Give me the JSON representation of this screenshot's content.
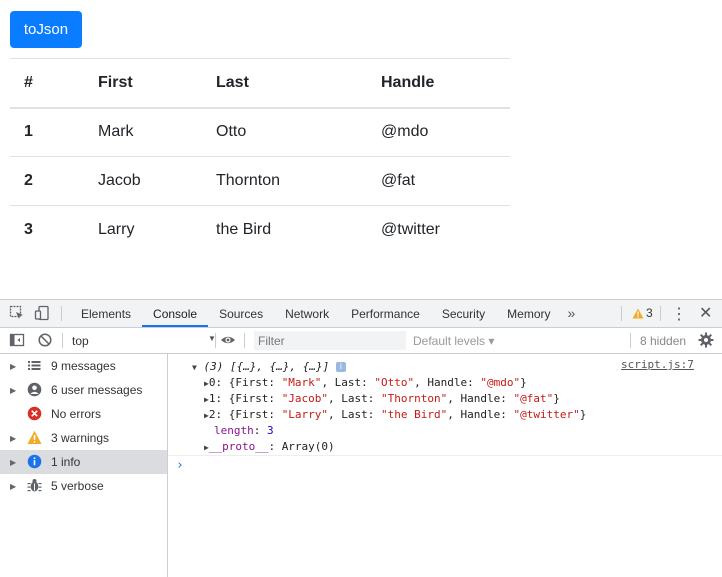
{
  "page": {
    "button_label": "toJson",
    "table": {
      "headers": [
        "#",
        "First",
        "Last",
        "Handle"
      ],
      "rows": [
        [
          "1",
          "Mark",
          "Otto",
          "@mdo"
        ],
        [
          "2",
          "Jacob",
          "Thornton",
          "@fat"
        ],
        [
          "3",
          "Larry",
          "the Bird",
          "@twitter"
        ]
      ]
    }
  },
  "devtools": {
    "tabs": [
      "Elements",
      "Console",
      "Sources",
      "Network",
      "Performance",
      "Security",
      "Memory"
    ],
    "active_tab": "Console",
    "more_tabs": "»",
    "warning_count": "3",
    "context": "top",
    "filter_placeholder": "Filter",
    "levels_label": "Default levels ▾",
    "hidden_count": "8 hidden",
    "sidebar": [
      {
        "label": "9 messages",
        "icon": "list-icon"
      },
      {
        "label": "6 user messages",
        "icon": "user-icon"
      },
      {
        "label": "No errors",
        "icon": "error-icon"
      },
      {
        "label": "3 warnings",
        "icon": "warning-icon"
      },
      {
        "label": "1 info",
        "icon": "info-icon"
      },
      {
        "label": "5 verbose",
        "icon": "bug-icon"
      }
    ],
    "log": {
      "summary": "(3) [{…}, {…}, {…}]",
      "source": "script.js:7",
      "items": [
        {
          "index": "0",
          "first": "\"Mark\"",
          "last": "\"Otto\"",
          "handle": "\"@mdo\""
        },
        {
          "index": "1",
          "first": "\"Jacob\"",
          "last": "\"Thornton\"",
          "handle": "\"@fat\""
        },
        {
          "index": "2",
          "first": "\"Larry\"",
          "last": "\"the Bird\"",
          "handle": "\"@twitter\""
        }
      ],
      "length_key": "length",
      "length_value": "3",
      "proto_key": "__proto__",
      "proto_value": "Array(0)"
    },
    "prompt_symbol": "›"
  },
  "colors": {
    "button": "#0a7cff",
    "active_tab": "#1a73e8",
    "string": "#c41a16",
    "number": "#1c00cf",
    "property": "#881391",
    "warning": "#f2ab26",
    "error": "#d93025",
    "info": "#1a73e8"
  }
}
